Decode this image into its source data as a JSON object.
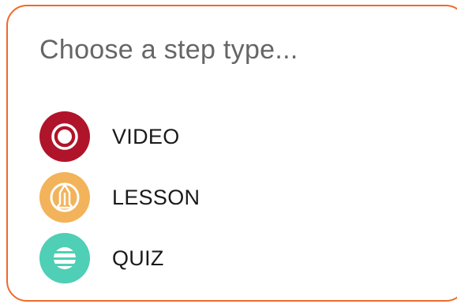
{
  "dialog": {
    "title": "Choose a step type...",
    "border_color": "#ee6a2a"
  },
  "options": [
    {
      "label": "VIDEO",
      "icon": "video-record-icon",
      "color": "#b0142a"
    },
    {
      "label": "LESSON",
      "icon": "lesson-icon",
      "color": "#f2b35a"
    },
    {
      "label": "QUIZ",
      "icon": "quiz-icon",
      "color": "#4fcfb5"
    }
  ]
}
